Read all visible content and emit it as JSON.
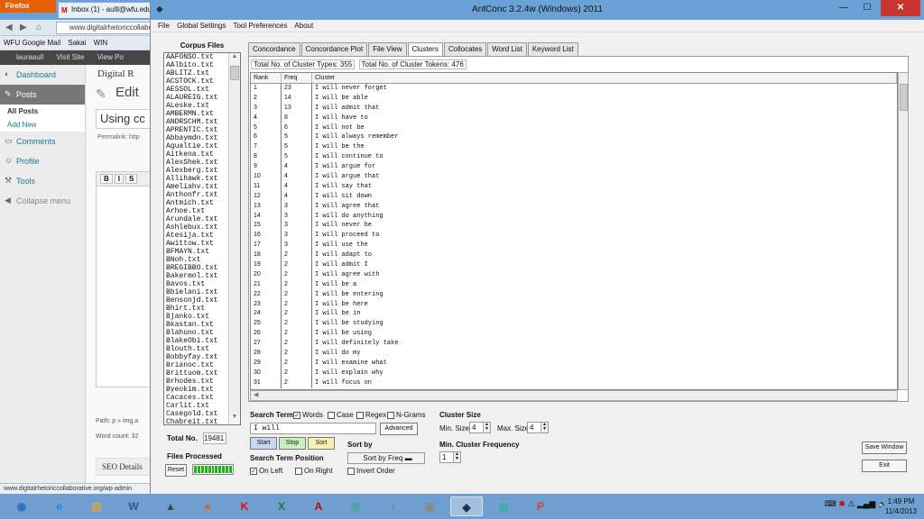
{
  "browser": {
    "menu_button": "Firefox",
    "tab_title": "Inbox (1) - aulll@wfu.edu",
    "url": "www.digitalrhetoriccollaborative.org",
    "bookmarks": [
      "WFU Google Mail",
      "Sakai",
      "WIN"
    ],
    "status_url": "www.digitalrhetoriccollaborative.org/wp-admin",
    "adminbar": {
      "user": "lauraaull",
      "visit": "Visit Site",
      "view": "View Po"
    }
  },
  "wordpress": {
    "menu": [
      {
        "label": "Dashboard",
        "icon": "dashboard-icon"
      },
      {
        "label": "Posts",
        "icon": "pin-icon"
      },
      {
        "label": "Comments",
        "icon": "comment-icon"
      },
      {
        "label": "Profile",
        "icon": "user-icon"
      },
      {
        "label": "Tools",
        "icon": "wrench-icon"
      }
    ],
    "submenu": [
      "All Posts",
      "Add New"
    ],
    "collapse": "Collapse menu",
    "site_title": "Digital R",
    "edit_heading": "Edit",
    "post_title": "Using cc",
    "permalink": "Permalink: http",
    "path": "Path: p » img.a",
    "word_count": "Word count: 32",
    "seo": "SEO Details"
  },
  "antconc": {
    "title": "AntConc 3.2.4w (Windows) 2011",
    "menu": [
      "File",
      "Global Settings",
      "Tool Preferences",
      "About"
    ],
    "corpus_label": "Corpus Files",
    "corpus_files": [
      "AAFONSO.txt",
      "AAlbito.txt",
      "ABLITZ.txt",
      "ACSTOCK.txt",
      "AESSOL.txt",
      "ALAUREIG.txt",
      "ALeske.txt",
      "AMBERMN.txt",
      "ANDRSCHM.txt",
      "APRENTIC.txt",
      "Abbaymdn.txt",
      "Agualtie.txt",
      "Aitkena.txt",
      "AlexShek.txt",
      "Alexberg.txt",
      "Allihawk.txt",
      "Ameliahv.txt",
      "Anthonfr.txt",
      "Antmich.txt",
      "Arhoe.txt",
      "Arundale.txt",
      "Ashlebux.txt",
      "Atesija.txt",
      "Awittow.txt",
      "BFMAYN.txt",
      "BNoh.txt",
      "BREGIBBO.txt",
      "Bakermol.txt",
      "Bavos.txt",
      "Bbielani.txt",
      "Bensonjd.txt",
      "Bhirt.txt",
      "Bjanko.txt",
      "Bkastan.txt",
      "Blahuno.txt",
      "BlakeObi.txt",
      "Blouth.txt",
      "Bobbyfay.txt",
      "Brianoc.txt",
      "Brittuom.txt",
      "Brhodes.txt",
      "Byeokim.txt",
      "Cacaces.txt",
      "Carlit.txt",
      "Casegold.txt",
      "Chabreit.txt"
    ],
    "total_no_label": "Total No.",
    "total_no": "19481",
    "files_processed_label": "Files Processed",
    "reset_label": "Reset",
    "tabs": [
      "Concordance",
      "Concordance Plot",
      "File View",
      "Clusters",
      "Collocates",
      "Word List",
      "Keyword List"
    ],
    "active_tab": "Clusters",
    "cluster_types_label": "Total No. of Cluster Types:",
    "cluster_types": "355",
    "cluster_tokens_label": "Total No. of Cluster Tokens:",
    "cluster_tokens": "476",
    "columns": [
      "Rank",
      "Freq",
      "Cluster"
    ],
    "rows": [
      [
        "1",
        "23",
        "I will never forget"
      ],
      [
        "2",
        "14",
        "I will be able"
      ],
      [
        "3",
        "13",
        "I will admit that"
      ],
      [
        "4",
        "8",
        "I will have to"
      ],
      [
        "5",
        "6",
        "I will not be"
      ],
      [
        "6",
        "5",
        "I will always remember"
      ],
      [
        "7",
        "5",
        "I will be the"
      ],
      [
        "8",
        "5",
        "I will continue to"
      ],
      [
        "9",
        "4",
        "I will argue for"
      ],
      [
        "10",
        "4",
        "I will argue that"
      ],
      [
        "11",
        "4",
        "I will say that"
      ],
      [
        "12",
        "4",
        "I will sit down"
      ],
      [
        "13",
        "3",
        "I will agree that"
      ],
      [
        "14",
        "3",
        "I will do anything"
      ],
      [
        "15",
        "3",
        "I will never be"
      ],
      [
        "16",
        "3",
        "I will proceed to"
      ],
      [
        "17",
        "3",
        "I will use the"
      ],
      [
        "18",
        "2",
        "I will adapt to"
      ],
      [
        "19",
        "2",
        "I will admit I"
      ],
      [
        "20",
        "2",
        "I will agree with"
      ],
      [
        "21",
        "2",
        "I will be a"
      ],
      [
        "22",
        "2",
        "I will be entering"
      ],
      [
        "23",
        "2",
        "I will be here"
      ],
      [
        "24",
        "2",
        "I will be in"
      ],
      [
        "25",
        "2",
        "I will be studying"
      ],
      [
        "26",
        "2",
        "I will be using"
      ],
      [
        "27",
        "2",
        "I will definitely take"
      ],
      [
        "28",
        "2",
        "I will do my"
      ],
      [
        "29",
        "2",
        "I will examine what"
      ],
      [
        "30",
        "2",
        "I will explain why"
      ],
      [
        "31",
        "2",
        "I will focus on"
      ]
    ],
    "search_term_label": "Search Term",
    "words_label": "Words",
    "case_label": "Case",
    "regex_label": "Regex",
    "ngrams_label": "N-Grams",
    "search_term": "I will",
    "advanced_label": "Advanced",
    "start_label": "Start",
    "stop_label": "Stop",
    "sort_label": "Sort",
    "search_position_label": "Search Term Position",
    "on_left_label": "On Left",
    "on_right_label": "On Right",
    "sort_by_label": "Sort by",
    "sort_by_value": "Sort by Freq",
    "invert_order_label": "Invert Order",
    "cluster_size_label": "Cluster Size",
    "min_size_label": "Min. Size",
    "min_size": "4",
    "max_size_label": "Max. Size",
    "max_size": "4",
    "min_freq_label": "Min. Cluster Frequency",
    "min_freq": "1",
    "save_window_label": "Save Window",
    "exit_label": "Exit"
  },
  "taskbar": {
    "apps": [
      "start-orb",
      "ie",
      "file-explorer",
      "word",
      "app-generic",
      "firefox",
      "kk-app",
      "excel",
      "acrobat",
      "app-browser",
      "app-media",
      "app-viewer",
      "antconc",
      "app-window",
      "powerpoint"
    ],
    "time": "1:49 PM",
    "date": "11/4/2013"
  }
}
